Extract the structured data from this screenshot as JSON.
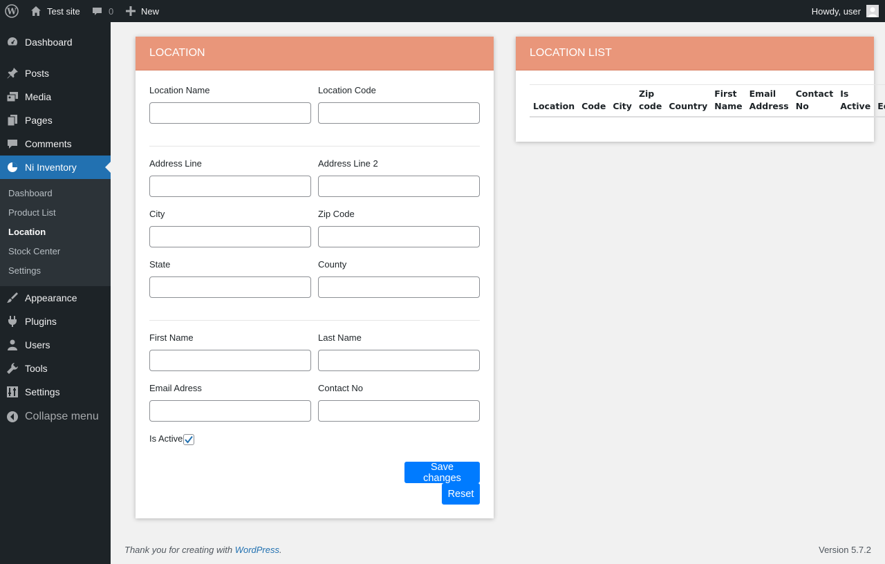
{
  "adminbar": {
    "site_name": "Test site",
    "comments_count": "0",
    "new_label": "New",
    "greeting": "Howdy, user"
  },
  "sidebar": {
    "items_top": [
      {
        "label": "Dashboard",
        "icon": "dashboard-icon"
      },
      {
        "label": "Posts",
        "icon": "pin-icon"
      },
      {
        "label": "Media",
        "icon": "media-icon"
      },
      {
        "label": "Pages",
        "icon": "pages-icon"
      },
      {
        "label": "Comments",
        "icon": "comments-icon"
      },
      {
        "label": "Ni Inventory",
        "icon": "pie-chart-icon"
      }
    ],
    "submenu": [
      {
        "label": "Dashboard"
      },
      {
        "label": "Product List"
      },
      {
        "label": "Location"
      },
      {
        "label": "Stock Center"
      },
      {
        "label": "Settings"
      }
    ],
    "items_bottom": [
      {
        "label": "Appearance",
        "icon": "brush-icon"
      },
      {
        "label": "Plugins",
        "icon": "plugin-icon"
      },
      {
        "label": "Users",
        "icon": "users-icon"
      },
      {
        "label": "Tools",
        "icon": "wrench-icon"
      },
      {
        "label": "Settings",
        "icon": "settings-icon"
      }
    ],
    "collapse_label": "Collapse menu"
  },
  "location_form": {
    "title": "LOCATION",
    "fields": {
      "location_name": {
        "label": "Location Name",
        "value": ""
      },
      "location_code": {
        "label": "Location Code",
        "value": ""
      },
      "address_line": {
        "label": "Address Line",
        "value": ""
      },
      "address_line2": {
        "label": "Address Line 2",
        "value": ""
      },
      "city": {
        "label": "City",
        "value": ""
      },
      "zip_code": {
        "label": "Zip Code",
        "value": ""
      },
      "state": {
        "label": "State",
        "value": ""
      },
      "county": {
        "label": "County",
        "value": ""
      },
      "first_name": {
        "label": "First Name",
        "value": ""
      },
      "last_name": {
        "label": "Last Name",
        "value": ""
      },
      "email_address": {
        "label": "Email Adress",
        "value": ""
      },
      "contact_no": {
        "label": "Contact No",
        "value": ""
      }
    },
    "is_active_label": "Is Active",
    "is_active_checked": true,
    "save_label": "Save changes",
    "reset_label": "Reset"
  },
  "location_list": {
    "title": "LOCATION LIST",
    "columns": [
      [
        "Location"
      ],
      [
        "Code"
      ],
      [
        "City"
      ],
      [
        "Zip",
        "code"
      ],
      [
        "Country"
      ],
      [
        "First",
        "Name"
      ],
      [
        "Email",
        "Address"
      ],
      [
        "Contact",
        "No"
      ],
      [
        "Is",
        "Active"
      ],
      [
        "Edit"
      ]
    ]
  },
  "footer": {
    "thanks_prefix": "Thank you for creating with ",
    "link_text": "WordPress",
    "thanks_suffix": ".",
    "version": "Version 5.7.2"
  },
  "colors": {
    "card_header": "#e9967a",
    "button": "#007bff",
    "admin_bg": "#1d2327",
    "menu_current": "#2271b1"
  }
}
